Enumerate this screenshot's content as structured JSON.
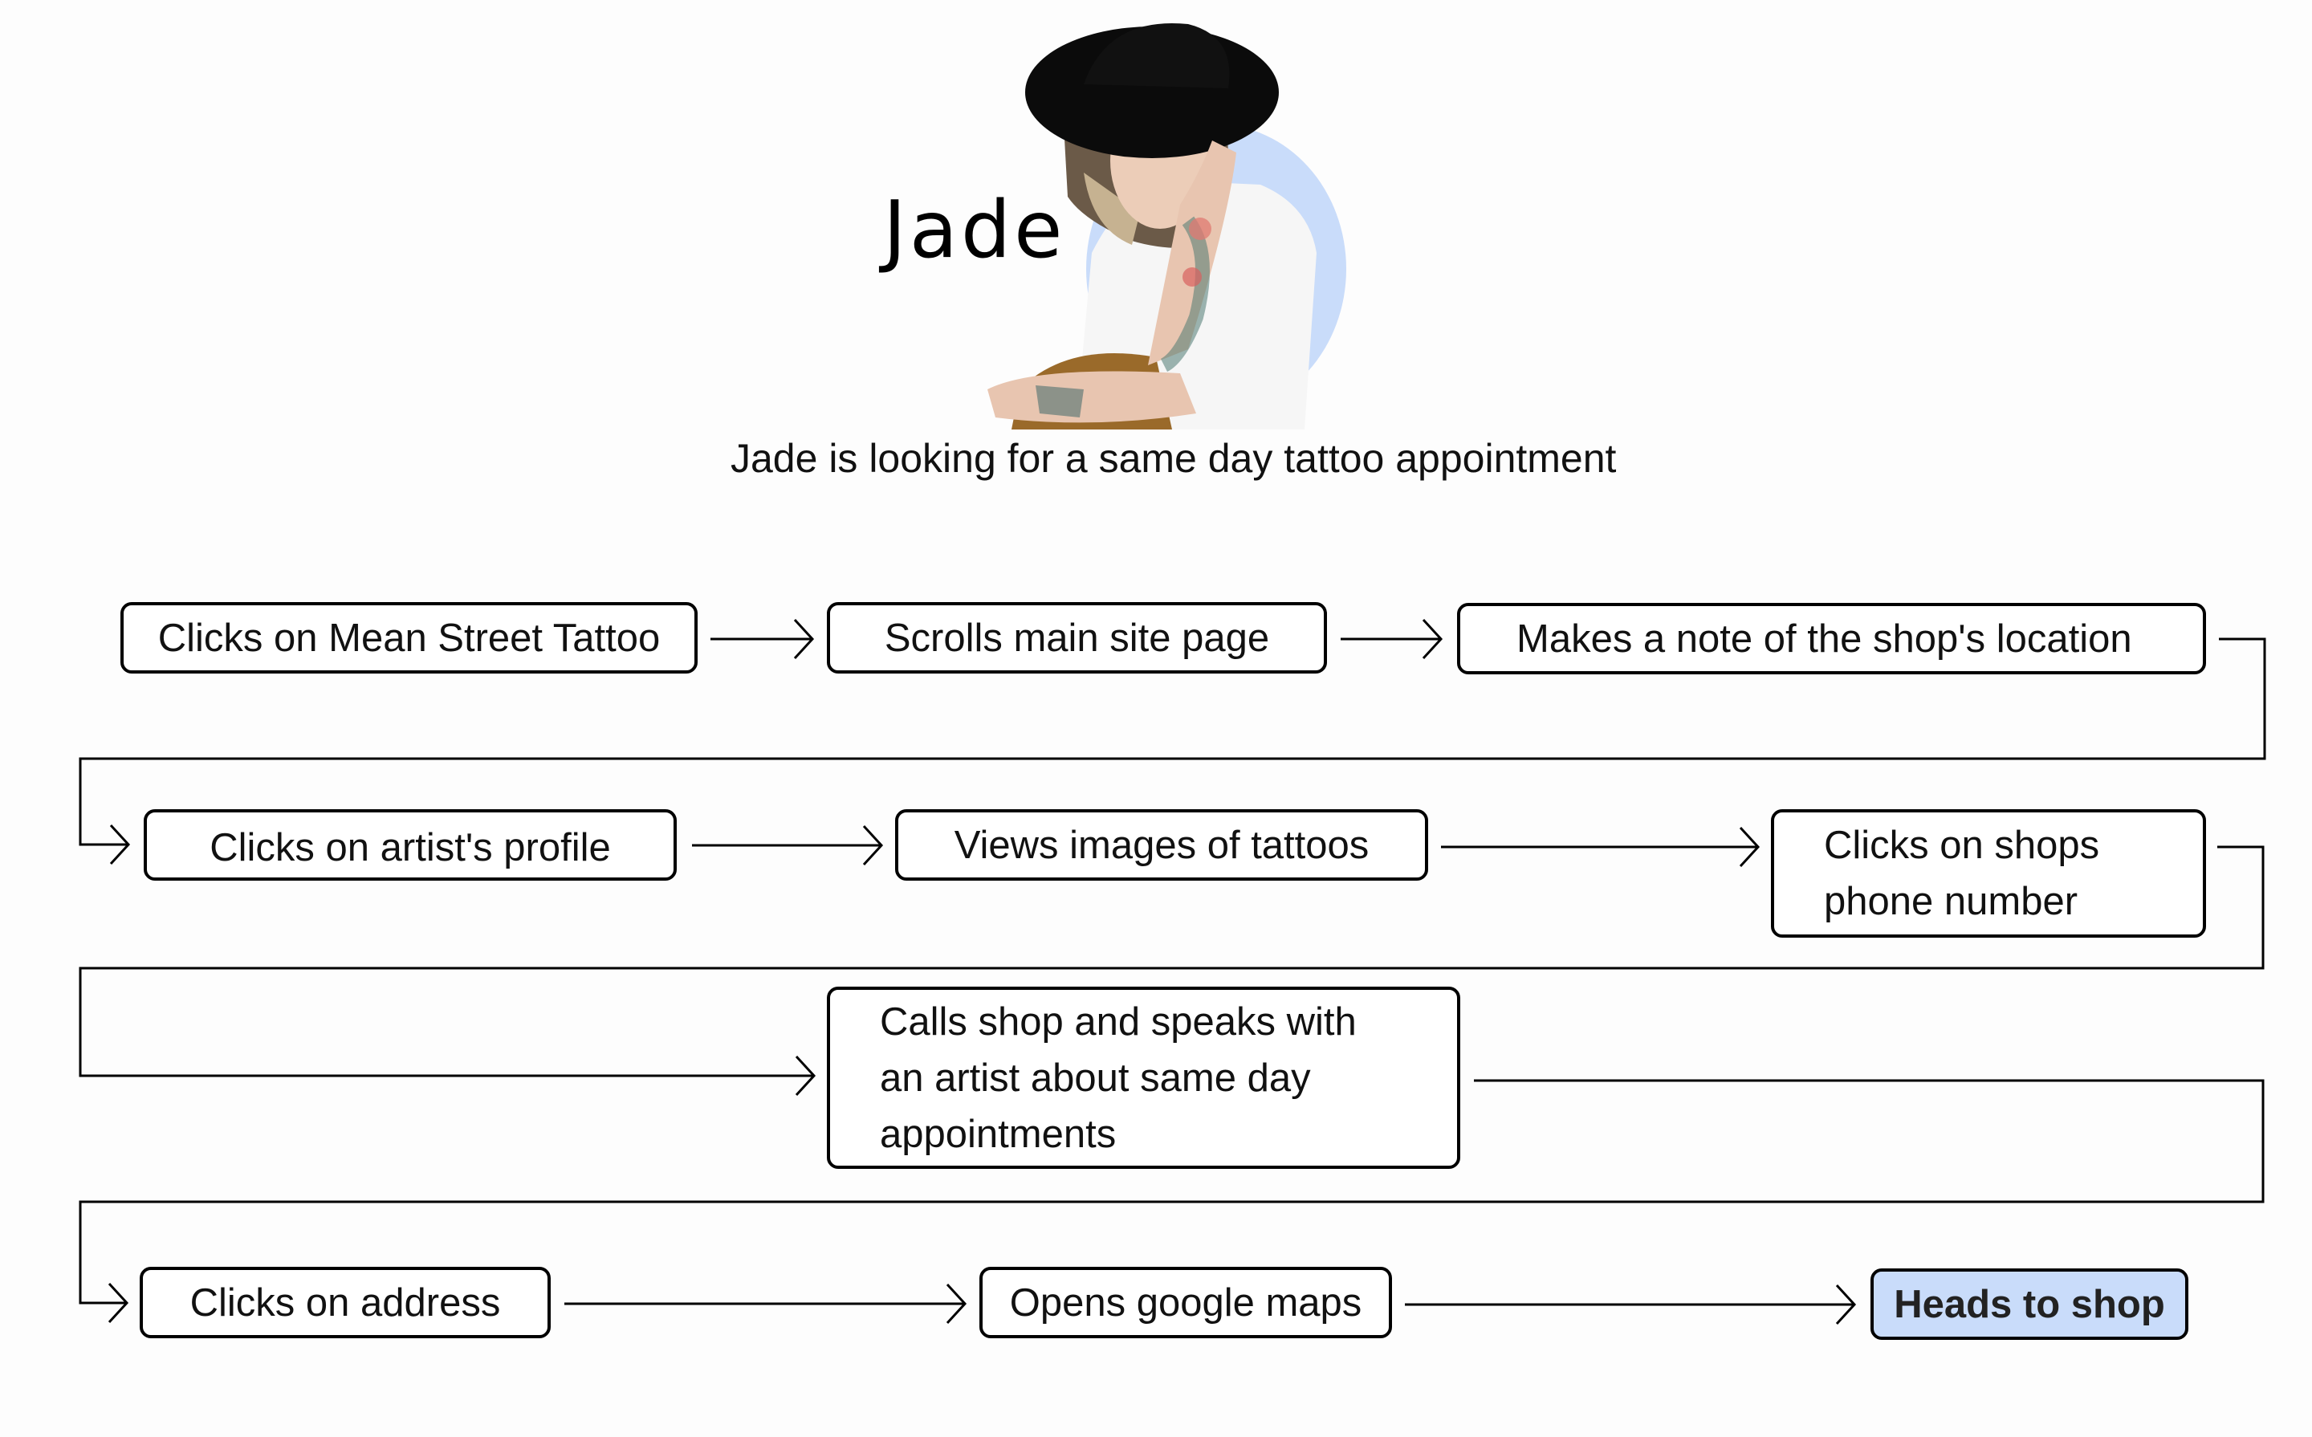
{
  "persona": {
    "name": "Jade",
    "description": "Jade is looking for a same day tattoo appointment",
    "photo_icon": "persona-photo",
    "accent_circle_color": "#c9dcfa"
  },
  "flow": {
    "steps": [
      {
        "id": 1,
        "label": "Clicks on Mean Street Tattoo"
      },
      {
        "id": 2,
        "label": "Scrolls main site page"
      },
      {
        "id": 3,
        "label": "Makes a note of the shop's location"
      },
      {
        "id": 4,
        "label": "Clicks on artist's profile"
      },
      {
        "id": 5,
        "label": "Views images of tattoos"
      },
      {
        "id": 6,
        "label_lines": [
          "Clicks on shops",
          "phone number"
        ]
      },
      {
        "id": 7,
        "label_lines": [
          "Calls shop and speaks with",
          "an artist about same day",
          "appointments"
        ]
      },
      {
        "id": 8,
        "label": "Clicks on address"
      },
      {
        "id": 9,
        "label": "Opens google maps"
      },
      {
        "id": 10,
        "label": "Heads to shop",
        "highlighted": true
      }
    ],
    "highlight_color": "#c9dcfa",
    "connector_icon": "arrow-right-icon"
  }
}
